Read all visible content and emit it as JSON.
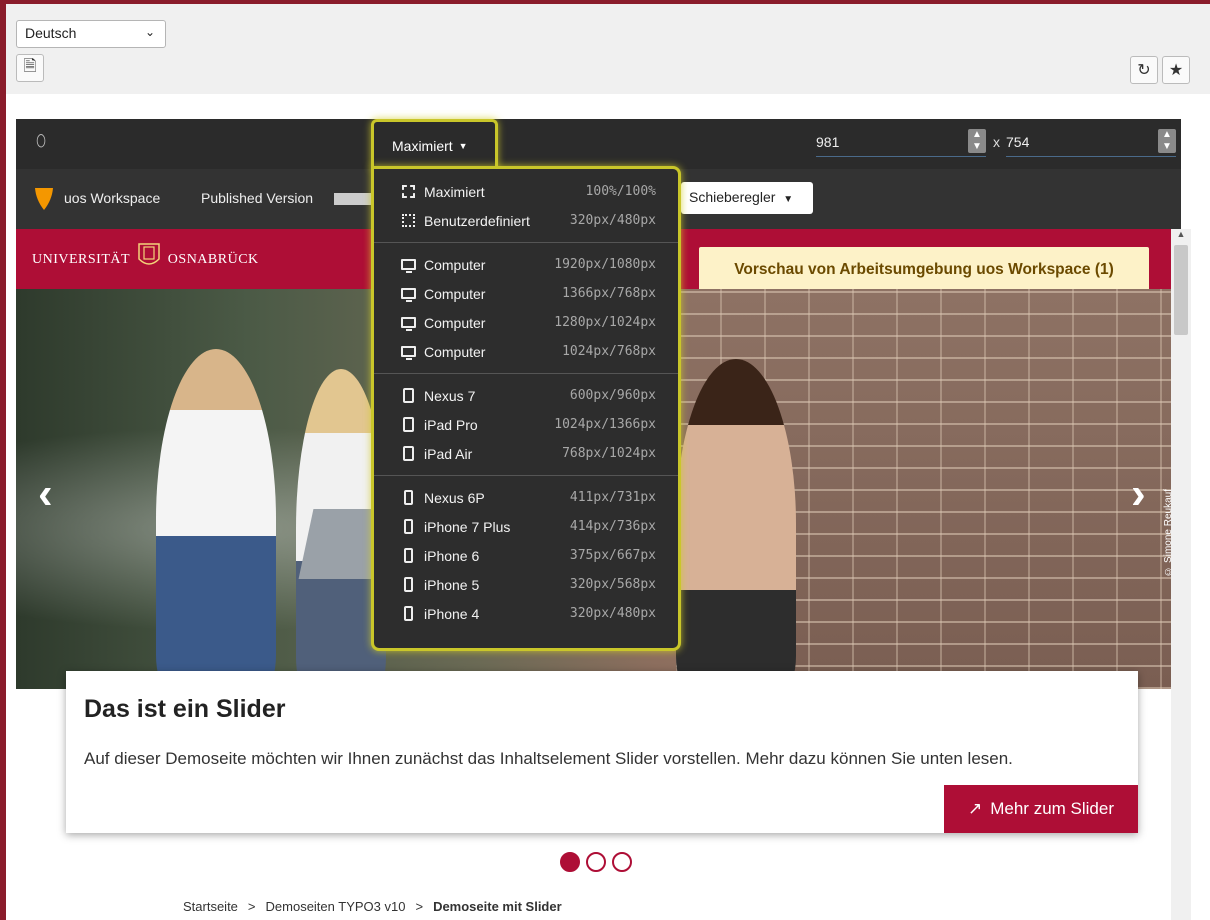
{
  "toolbar": {
    "language": "Deutsch"
  },
  "preview": {
    "width_value": "981",
    "height_value": "754",
    "dimension_separator": "x",
    "workspace_name": "uos Workspace",
    "published_version_label": "Published Version",
    "slider_mode_label": "Schieberegler",
    "notice": "Vorschau von Arbeitsumgebung uos Workspace (1)"
  },
  "dropdown": {
    "selected": "Maximiert",
    "groups": [
      [
        {
          "label": "Maximiert",
          "res": "100%/100%",
          "icon": "maximize-icon"
        },
        {
          "label": "Benutzerdefiniert",
          "res": "320px/480px",
          "icon": "custom-size-icon"
        }
      ],
      [
        {
          "label": "Computer",
          "res": "1920px/1080px",
          "icon": "monitor-icon"
        },
        {
          "label": "Computer",
          "res": "1366px/768px",
          "icon": "monitor-icon"
        },
        {
          "label": "Computer",
          "res": "1280px/1024px",
          "icon": "monitor-icon"
        },
        {
          "label": "Computer",
          "res": "1024px/768px",
          "icon": "monitor-icon"
        }
      ],
      [
        {
          "label": "Nexus 7",
          "res": "600px/960px",
          "icon": "tablet-icon"
        },
        {
          "label": "iPad Pro",
          "res": "1024px/1366px",
          "icon": "tablet-icon"
        },
        {
          "label": "iPad Air",
          "res": "768px/1024px",
          "icon": "tablet-icon"
        }
      ],
      [
        {
          "label": "Nexus 6P",
          "res": "411px/731px",
          "icon": "phone-icon"
        },
        {
          "label": "iPhone 7 Plus",
          "res": "414px/736px",
          "icon": "phone-icon"
        },
        {
          "label": "iPhone 6",
          "res": "375px/667px",
          "icon": "phone-icon"
        },
        {
          "label": "iPhone 5",
          "res": "320px/568px",
          "icon": "phone-icon"
        },
        {
          "label": "iPhone 4",
          "res": "320px/480px",
          "icon": "phone-icon"
        }
      ]
    ]
  },
  "site": {
    "logo_left": "UNIVERSITÄT",
    "logo_right": "OSNABRÜCK",
    "photo_credit": "© Simone Reukauf",
    "slider_title": "Das ist ein Slider",
    "slider_text": "Auf dieser Demoseite möchten wir Ihnen zunächst das Inhaltselement Slider vorstellen. Mehr dazu können Sie unten lesen.",
    "more_button": "Mehr zum Slider",
    "breadcrumb": [
      "Startseite",
      "Demoseiten TYPO3 v10",
      "Demoseite mit Slider"
    ],
    "breadcrumb_separator": ">"
  },
  "colors": {
    "brand": "#ae0e36",
    "highlight": "#c9c62a"
  }
}
